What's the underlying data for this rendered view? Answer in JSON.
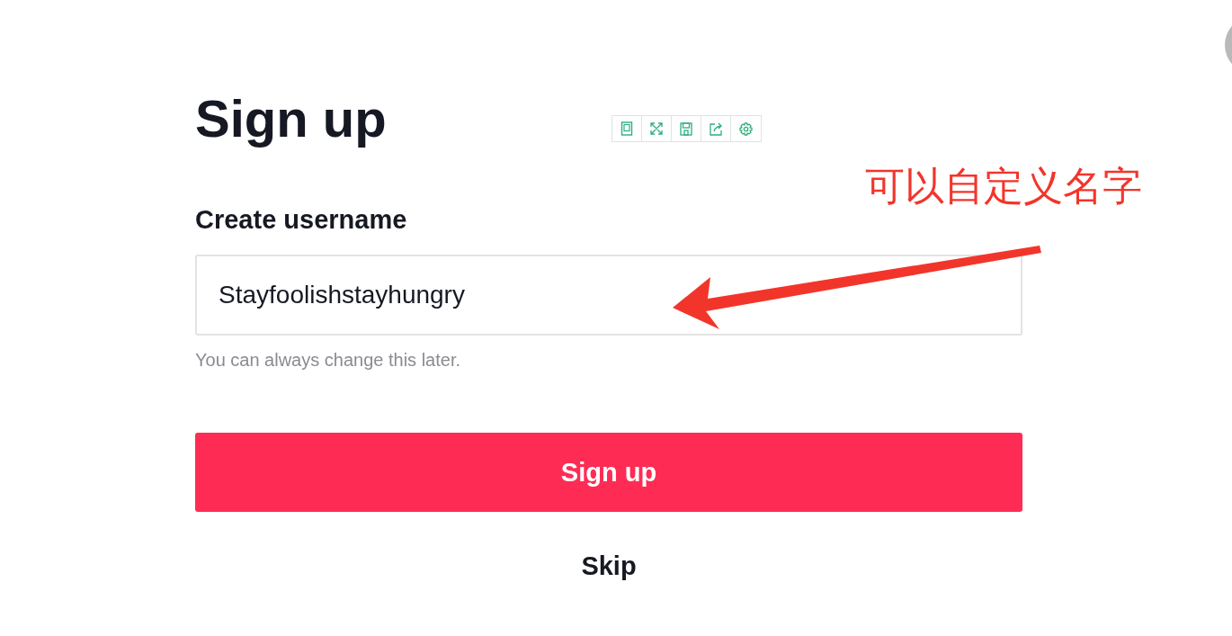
{
  "title": "Sign up",
  "username": {
    "label": "Create username",
    "value": "Stayfoolishstayhungry",
    "hint": "You can always change this later."
  },
  "submit_button": "Sign up",
  "skip_link": "Skip",
  "annotation": {
    "text": "可以自定义名字"
  }
}
